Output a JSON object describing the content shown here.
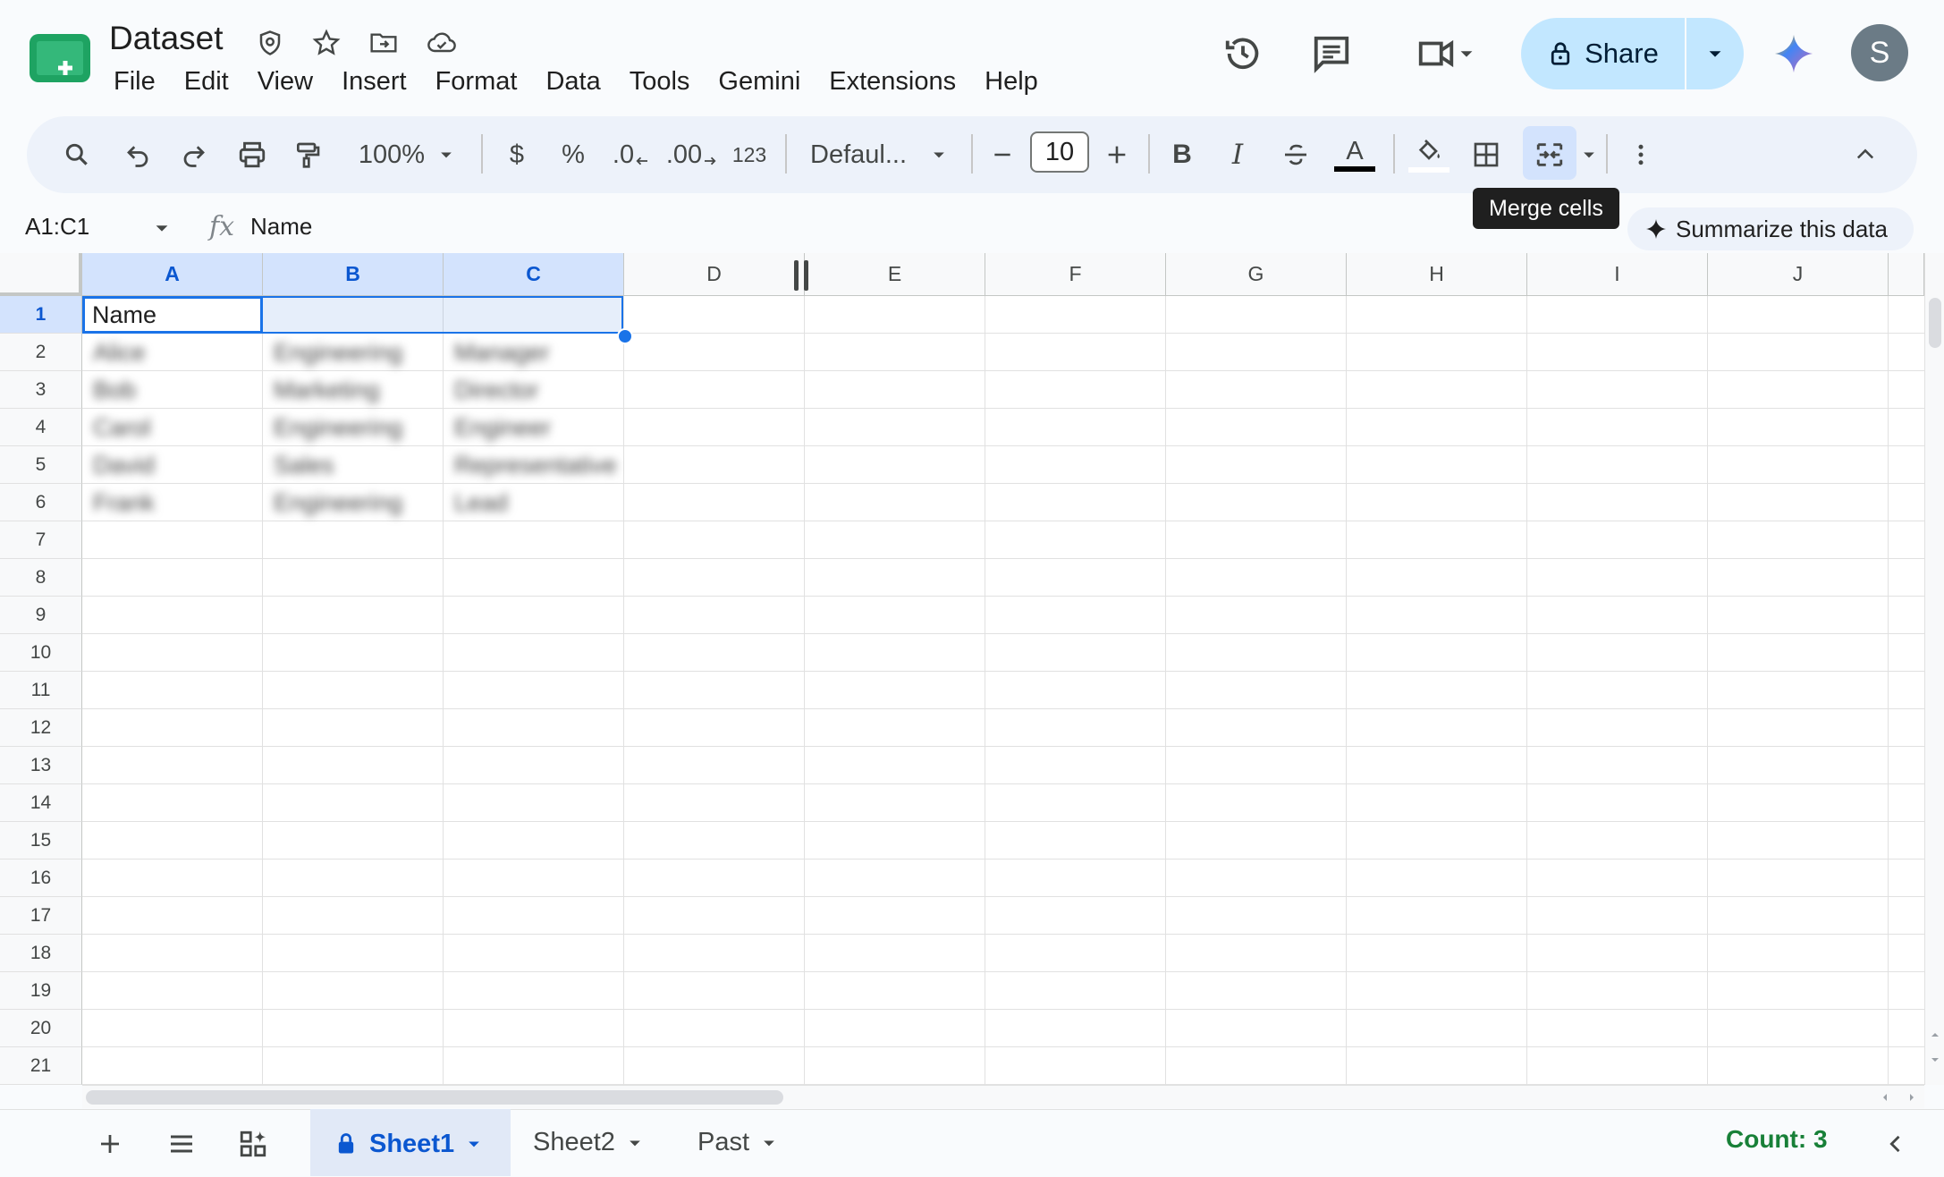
{
  "app": {
    "title": "Dataset",
    "menu": [
      "File",
      "Edit",
      "View",
      "Insert",
      "Format",
      "Data",
      "Tools",
      "Gemini",
      "Extensions",
      "Help"
    ],
    "share_label": "Share",
    "avatar_initial": "S"
  },
  "toolbar": {
    "zoom": "100%",
    "currency": "$",
    "percent": "%",
    "decrease_decimal": ".0",
    "increase_decimal": ".00",
    "number_format": "123",
    "font": "Defaul...",
    "font_size": "10",
    "bold": "B",
    "italic": "I",
    "text_color_letter": "A",
    "merge_tooltip": "Merge cells"
  },
  "formula_bar": {
    "name_box": "A1:C1",
    "fx": "fx",
    "value": "Name",
    "summarize_label": "Summarize this data"
  },
  "grid": {
    "columns": [
      "A",
      "B",
      "C",
      "D",
      "E",
      "F",
      "G",
      "H",
      "I",
      "J"
    ],
    "selected_columns": [
      "A",
      "B",
      "C"
    ],
    "rows": [
      "1",
      "2",
      "3",
      "4",
      "5",
      "6",
      "7",
      "8",
      "9",
      "10",
      "11",
      "12",
      "13",
      "14",
      "15",
      "16",
      "17",
      "18",
      "19",
      "20",
      "21"
    ],
    "selected_row": "1",
    "cells": {
      "A1": "Name"
    },
    "blurred_rows": [
      [
        "Alice",
        "Engineering",
        "Manager"
      ],
      [
        "Bob",
        "Marketing",
        "Director"
      ],
      [
        "Carol",
        "Engineering",
        "Engineer"
      ],
      [
        "David",
        "Sales",
        "Representative"
      ],
      [
        "Frank",
        "Engineering",
        "Lead"
      ]
    ]
  },
  "sheets": {
    "tabs": [
      "Sheet1",
      "Sheet2",
      "Past"
    ],
    "active": "Sheet1",
    "status": "Count: 3"
  },
  "colors": {
    "accent": "#0b57d0",
    "selection": "#1a73e8",
    "share_bg": "#c2e7ff",
    "status_green": "#188038"
  }
}
